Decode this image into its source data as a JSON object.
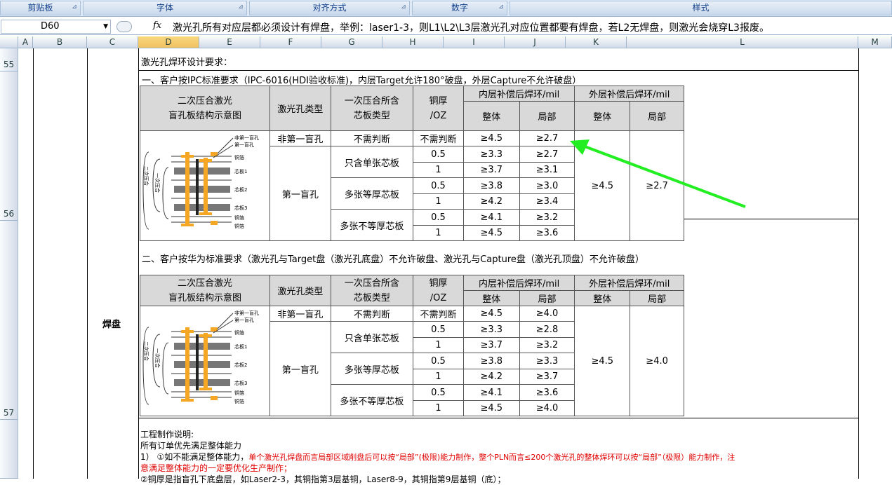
{
  "ribbon": {
    "groups": [
      "剪贴板",
      "字体",
      "对齐方式",
      "数字",
      "样式"
    ]
  },
  "formula_bar": {
    "name_box": "D60",
    "fx_label": "fx",
    "content": "激光孔所有对应层都必须设计有焊盘，举例：laser1-3，则L1\\L2\\L3层激光孔对应位置都要有焊盘，若L2无焊盘，则激光会烧穿L3报废。"
  },
  "columns": [
    "A",
    "B",
    "C",
    "D",
    "E",
    "F",
    "G",
    "H",
    "I",
    "J",
    "K",
    "L",
    "M"
  ],
  "rows": [
    "55",
    "56",
    "57"
  ],
  "sheet": {
    "header_cell": "激光孔焊环设计要求：",
    "side_label": "焊盘",
    "section1_title": "一、客户按IPC标准要求（IPC-6016(HDI验收标准)，内层Target允许180°破盘，外层Capture不允许破盘）",
    "section2_title": "二、客户按华为标准要求（激光孔与Target盘（激光孔底盘）不允许破盘、激光孔与Capture盘（激光孔顶盘）不允许破盘）",
    "table_headers": {
      "structure": [
        "二次压合激光",
        "盲孔板结构示意图"
      ],
      "hole_type": "激光孔类型",
      "core_type": [
        "一次压合所含",
        "芯板类型"
      ],
      "copper": [
        "铜厚",
        "/OZ"
      ],
      "inner": "内层补偿后焊环/mil",
      "outer": "外层补偿后焊环/mil",
      "whole": "整体",
      "local": "局部"
    },
    "diagram_labels": [
      "非第一盲孔",
      "第一盲孔",
      "铜箔",
      "芯板1",
      "芯板2",
      "芯板3",
      "铜箔",
      "铜箔",
      "二次压合",
      "一次压合"
    ],
    "table1": {
      "row_first": [
        "非第一盲孔",
        "不需判断",
        "不需判断",
        "≥4.5",
        "≥2.7"
      ],
      "first_blind": "第一盲孔",
      "groups": [
        {
          "core": "只含单张芯板",
          "rows": [
            [
              "0.5",
              "≥3.3",
              "≥2.7"
            ],
            [
              "1",
              "≥3.7",
              "≥3.1"
            ]
          ]
        },
        {
          "core": "多张等厚芯板",
          "rows": [
            [
              "0.5",
              "≥3.8",
              "≥3.0"
            ],
            [
              "1",
              "≥4.2",
              "≥3.4"
            ]
          ]
        },
        {
          "core": "多张不等厚芯板",
          "rows": [
            [
              "0.5",
              "≥4.1",
              "≥3.2"
            ],
            [
              "1",
              "≥4.5",
              "≥3.6"
            ]
          ]
        }
      ],
      "outer_whole": "≥4.5",
      "outer_local": "≥2.7"
    },
    "table2": {
      "row_first": [
        "非第一盲孔",
        "不需判断",
        "不需判断",
        "≥4.5",
        "≥4.0"
      ],
      "first_blind": "第一盲孔",
      "groups": [
        {
          "core": "只含单张芯板",
          "rows": [
            [
              "0.5",
              "≥3.3",
              "≥2.8"
            ],
            [
              "1",
              "≥3.7",
              "≥3.2"
            ]
          ]
        },
        {
          "core": "多张等厚芯板",
          "rows": [
            [
              "0.5",
              "≥3.8",
              "≥3.3"
            ],
            [
              "1",
              "≥4.2",
              "≥3.7"
            ]
          ]
        },
        {
          "core": "多张不等厚芯板",
          "rows": [
            [
              "0.5",
              "≥4.1",
              "≥3.6"
            ],
            [
              "1",
              "≥4.5",
              "≥4.0"
            ]
          ]
        }
      ],
      "outer_whole": "≥4.5",
      "outer_local": "≥4.0"
    },
    "notes": {
      "title": "工程制作说明:",
      "line1": "所有订单优先满足整体能力",
      "line2_prefix": "1）   ①如不能满足整体能力，",
      "line2_red": "单个激光孔焊盘而言局部区域削盘后可以按“局部”(极限)能力制作，整个PLN而言≤200个激光孔的整体焊环可以按“局部”（极限）能力制作，注",
      "line3_red": "意满足整体能力的一定要优化生产制作；",
      "line4": "      ②铜厚是指盲孔下底盘层，如Laser2-3，其铜指第3层基铜，Laser8-9，其铜指第9层基铜（底）；"
    },
    "colors": {
      "arrow": "#22ee22",
      "header_fill": "#d9d9d9",
      "note_red": "#e00000",
      "diagram_copper": "#f5a623"
    }
  }
}
